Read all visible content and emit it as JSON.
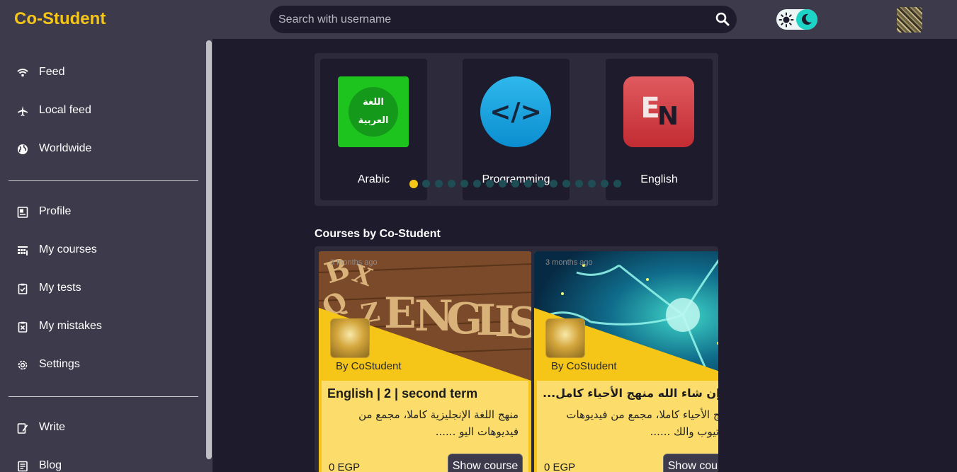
{
  "header": {
    "brand": "Co-Student",
    "search": {
      "placeholder": "Search with username"
    },
    "icons": {
      "search": "search-icon",
      "sun": "sun-icon",
      "moon": "moon-icon"
    }
  },
  "sidebar": {
    "items": [
      {
        "label": "Feed",
        "icon": "wifi-icon"
      },
      {
        "label": "Local feed",
        "icon": "plane-icon"
      },
      {
        "label": "Worldwide",
        "icon": "globe-icon"
      },
      {
        "label": "Profile",
        "icon": "id-card-icon"
      },
      {
        "label": "My courses",
        "icon": "course-icon"
      },
      {
        "label": "My tests",
        "icon": "clipboard-check-icon"
      },
      {
        "label": "My mistakes",
        "icon": "clipboard-x-icon"
      },
      {
        "label": "Settings",
        "icon": "gear-icon"
      },
      {
        "label": "Write",
        "icon": "write-icon"
      },
      {
        "label": "Blog",
        "icon": "blog-icon"
      }
    ]
  },
  "categories": {
    "items": [
      {
        "label": "Arabic",
        "icon_text_1": "اللغة",
        "icon_text_2": "العربية"
      },
      {
        "label": "Programming",
        "icon_text": "</>"
      },
      {
        "label": "English",
        "icon_text_1": "E",
        "icon_text_2": "N"
      }
    ],
    "dots_count": 17,
    "active_dot": 0
  },
  "courses": {
    "section_title": "Courses by Co-Student",
    "items": [
      {
        "time": "3 months ago",
        "by": "By CoStudent",
        "title": "English | 2 | second term",
        "description": "منهج اللغة الإنجليزية كاملا، مجمع من فيديوهات اليو ......",
        "price": "0 EGP",
        "button": "Show course"
      },
      {
        "time": "3 months ago",
        "by": "By CoStudent",
        "title": "إن شاء الله منهج الأحياء كامل...",
        "description": "منهج الأحياء كاملا، مجمع من فيديوهات اليوتيوب والك ......",
        "price": "0 EGP",
        "button": "Show course"
      }
    ]
  },
  "colors": {
    "accent": "#f5c518",
    "header_bg": "#3d3b4b",
    "page_bg": "#1e1b2c",
    "toggle_accent": "#1dd3c6"
  }
}
